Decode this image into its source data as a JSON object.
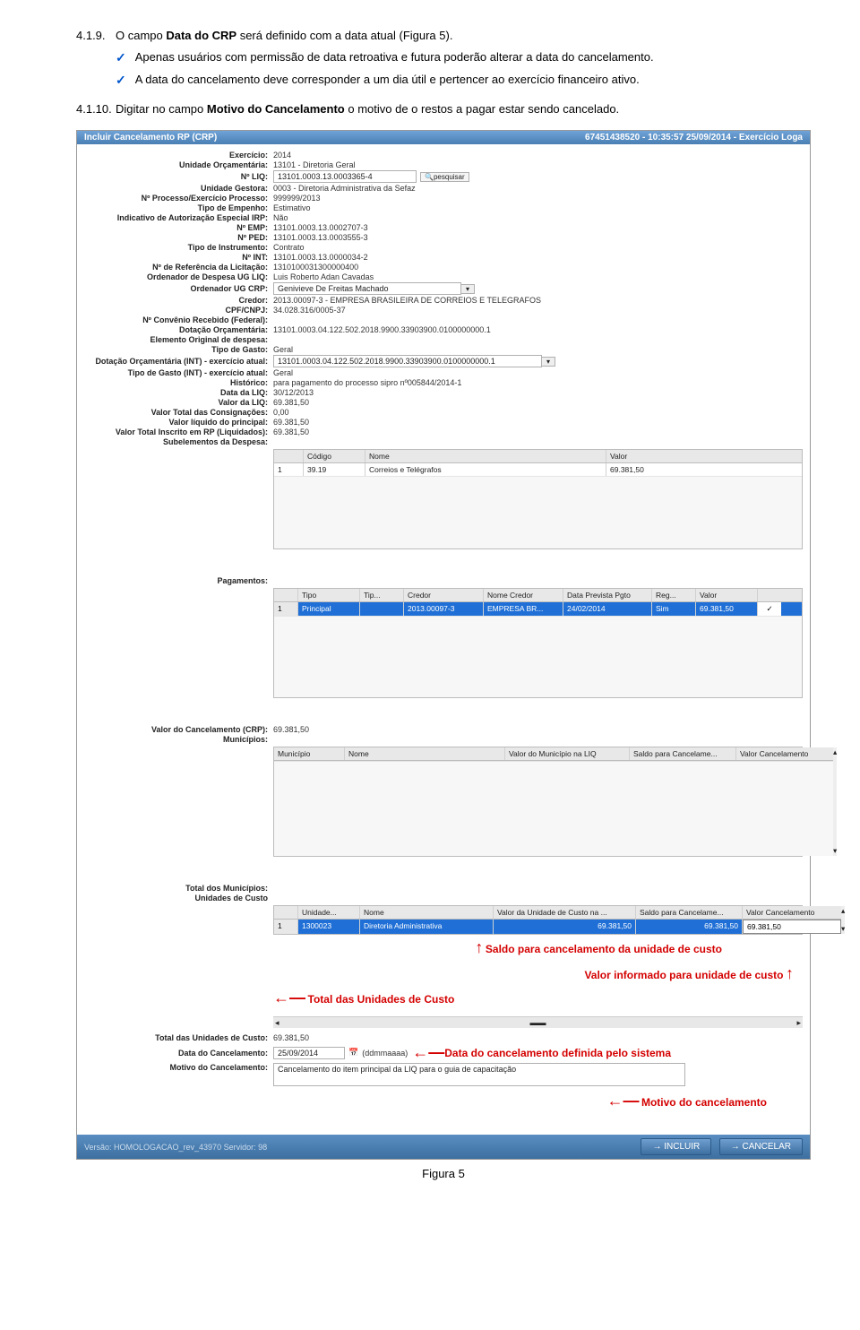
{
  "doc": {
    "num1": "4.1.9.",
    "line1a": "O campo ",
    "line1b": "Data do CRP",
    "line1c": " será definido com a data atual (Figura 5).",
    "bullet1": "Apenas usuários com permissão de data retroativa e futura poderão alterar a data do cancelamento.",
    "bullet2": "A data do cancelamento deve corresponder a um dia útil e pertencer ao exercício financeiro ativo.",
    "num2": "4.1.10.",
    "line2a": "Digitar no campo ",
    "line2b": "Motivo do Cancelamento",
    "line2c": " o motivo de o restos a pagar estar sendo cancelado.",
    "figure": "Figura 5"
  },
  "titlebar": {
    "left": "Incluir Cancelamento RP (CRP)",
    "right": "67451438520 - 10:35:57 25/09/2014 - Exercício Loga"
  },
  "form": {
    "exercicio": {
      "label": "Exercício:",
      "value": "2014"
    },
    "uo": {
      "label": "Unidade Orçamentária:",
      "value": "13101 - Diretoria Geral"
    },
    "liq": {
      "label": "Nº LIQ:",
      "value": "13101.0003.13.0003365-4",
      "btn": "pesquisar"
    },
    "ug": {
      "label": "Unidade Gestora:",
      "value": "0003 - Diretoria Administrativa da Sefaz"
    },
    "proc": {
      "label": "Nº Processo/Exercício Processo:",
      "value": "999999/2013"
    },
    "tipoemp": {
      "label": "Tipo de Empenho:",
      "value": "Estimativo"
    },
    "indaut": {
      "label": "Indicativo de Autorização Especial IRP:",
      "value": "Não"
    },
    "nemp": {
      "label": "Nº EMP:",
      "value": "13101.0003.13.0002707-3"
    },
    "nped": {
      "label": "Nº PED:",
      "value": "13101.0003.13.0003555-3"
    },
    "tipoinst": {
      "label": "Tipo de Instrumento:",
      "value": "Contrato"
    },
    "nint": {
      "label": "Nº INT:",
      "value": "13101.0003.13.0000034-2"
    },
    "reflic": {
      "label": "Nº de Referência da Licitação:",
      "value": "1310100031300000400"
    },
    "ordugliq": {
      "label": "Ordenador de Despesa UG LIQ:",
      "value": "Luis Roberto Adan Cavadas"
    },
    "ordugcrp": {
      "label": "Ordenador UG CRP:",
      "value": "Genivieve De Freitas Machado"
    },
    "credor": {
      "label": "Credor:",
      "value": "2013.00097-3 - EMPRESA BRASILEIRA DE CORREIOS E TELEGRAFOS"
    },
    "cpf": {
      "label": "CPF/CNPJ:",
      "value": "34.028.316/0005-37"
    },
    "convfed": {
      "label": "Nº Convênio Recebido (Federal):",
      "value": ""
    },
    "dotorc": {
      "label": "Dotação Orçamentária:",
      "value": "13101.0003.04.122.502.2018.9900.33903900.0100000000.1"
    },
    "elemorig": {
      "label": "Elemento Original de despesa:",
      "value": ""
    },
    "tipogasto": {
      "label": "Tipo de Gasto:",
      "value": "Geral"
    },
    "dotorcint": {
      "label": "Dotação Orçamentária (INT) - exercício atual:",
      "value": "13101.0003.04.122.502.2018.9900.33903900.0100000000.1"
    },
    "tipogastoint": {
      "label": "Tipo de Gasto (INT) - exercício atual:",
      "value": "Geral"
    },
    "hist": {
      "label": "Histórico:",
      "value": "para pagamento do processo sipro nº005844/2014-1"
    },
    "dataliq": {
      "label": "Data da LIQ:",
      "value": "30/12/2013"
    },
    "valorliq": {
      "label": "Valor da LIQ:",
      "value": "69.381,50"
    },
    "valconsig": {
      "label": "Valor Total das Consignações:",
      "value": "0,00"
    },
    "valliqprinc": {
      "label": "Valor líquido do principal:",
      "value": "69.381,50"
    },
    "valtotrp": {
      "label": "Valor Total Inscrito em RP (Liquidados):",
      "value": "69.381,50"
    },
    "subel": {
      "label": "Subelementos da Despesa:"
    }
  },
  "subel_grid": {
    "h": [
      "",
      "Código",
      "Nome",
      "Valor"
    ],
    "r1": [
      "1",
      "39.19",
      "Correios e Telégrafos",
      "69.381,50"
    ]
  },
  "pag": {
    "label": "Pagamentos:",
    "h": [
      "",
      "Tipo",
      "Tip...",
      "Credor",
      "Nome Credor",
      "Data Prevista Pgto",
      "Reg...",
      "Valor",
      ""
    ],
    "r1": [
      "1",
      "Principal",
      "",
      "2013.00097-3",
      "EMPRESA BR...",
      "24/02/2014",
      "Sim",
      "69.381,50",
      "✓"
    ]
  },
  "valcrp": {
    "label": "Valor do Cancelamento (CRP):",
    "value": "69.381,50"
  },
  "mun": {
    "label": "Municípios:",
    "h": [
      "Município",
      "Nome",
      "Valor do Município na LIQ",
      "Saldo para Cancelame...",
      "Valor Cancelamento"
    ]
  },
  "totmun": {
    "label": "Total dos Municípios:"
  },
  "uc": {
    "label": "Unidades de Custo",
    "h": [
      "",
      "Unidade...",
      "Nome",
      "Valor da Unidade de Custo na ...",
      "Saldo para Cancelame...",
      "Valor Cancelamento"
    ],
    "r1": [
      "1",
      "1300023",
      "Diretoria Administrativa",
      "69.381,50",
      "69.381,50",
      "69.381,50"
    ]
  },
  "annot": {
    "saldo": "Saldo para cancelamento da unidade de custo",
    "valor": "Valor informado para unidade de custo",
    "total": "Total das Unidades de Custo",
    "data": "Data do cancelamento definida pelo sistema",
    "motivo": "Motivo do cancelamento"
  },
  "totuc": {
    "label": "Total das Unidades de Custo:",
    "value": "69.381,50"
  },
  "datacanc": {
    "label": "Data do Cancelamento:",
    "value": "25/09/2014",
    "hint": "(ddmmaaaa)"
  },
  "motivo": {
    "label": "Motivo do Cancelamento:",
    "value": "Cancelamento do item principal da LIQ para o guia de capacitação"
  },
  "footer": {
    "ver": "Versão: HOMOLOGACAO_rev_43970  Servidor: 98",
    "incluir": "→ INCLUIR",
    "cancelar": "→ CANCELAR"
  }
}
